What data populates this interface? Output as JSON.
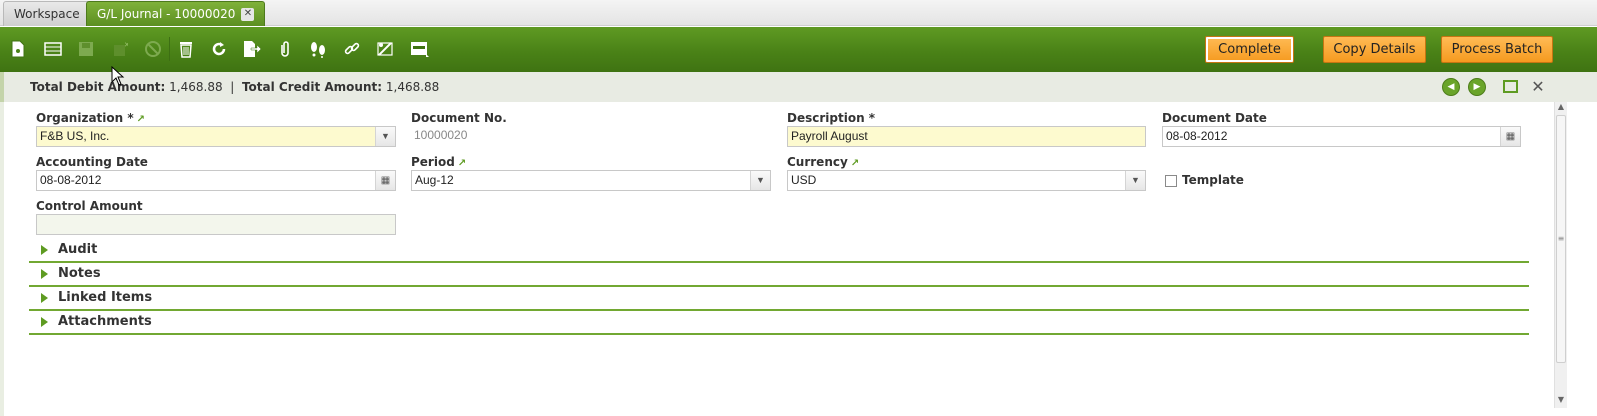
{
  "tabs": [
    {
      "label": "Workspace",
      "active": false
    },
    {
      "label": "G/L Journal - 10000020",
      "active": true,
      "close": "✕"
    }
  ],
  "toolbar": {
    "buttons": [
      {
        "icon": "new-document-icon",
        "enabled": true
      },
      {
        "icon": "grid-view-icon",
        "enabled": true
      },
      {
        "icon": "save-icon",
        "enabled": false
      },
      {
        "icon": "undo-icon",
        "enabled": false
      },
      {
        "icon": "cancel-icon",
        "enabled": false
      },
      {
        "icon": "delete-icon",
        "enabled": true
      },
      {
        "icon": "refresh-icon",
        "enabled": true
      },
      {
        "icon": "export-icon",
        "enabled": true
      },
      {
        "icon": "attachment-icon",
        "enabled": true
      },
      {
        "icon": "audit-trail-icon",
        "enabled": true
      },
      {
        "icon": "link-icon",
        "enabled": true
      },
      {
        "icon": "tools-icon",
        "enabled": true
      },
      {
        "icon": "layout-icon",
        "enabled": true
      }
    ],
    "actions": {
      "complete": "Complete",
      "copy_details": "Copy Details",
      "process_batch": "Process Batch"
    }
  },
  "status": {
    "debit_label": "Total Debit Amount:",
    "debit_value": "1,468.88",
    "separator": "|",
    "credit_label": "Total Credit Amount:",
    "credit_value": "1,468.88"
  },
  "form": {
    "organization": {
      "label": "Organization *",
      "value": "F&B US, Inc."
    },
    "document_no": {
      "label": "Document No.",
      "value": "10000020"
    },
    "description": {
      "label": "Description *",
      "value": "Payroll August"
    },
    "document_date": {
      "label": "Document Date",
      "value": "08-08-2012"
    },
    "accounting_date": {
      "label": "Accounting Date",
      "value": "08-08-2012"
    },
    "period": {
      "label": "Period",
      "value": "Aug-12"
    },
    "currency": {
      "label": "Currency",
      "value": "USD"
    },
    "template": {
      "label": "Template",
      "checked": false
    },
    "control_amount": {
      "label": "Control Amount",
      "value": ""
    }
  },
  "sections": [
    "Audit",
    "Notes",
    "Linked Items",
    "Attachments"
  ],
  "colors": {
    "toolbar_green": "#4a8217",
    "accent_green": "#72a832",
    "action_orange": "#f59a1f",
    "mandatory_yellow": "#fdfacf"
  }
}
